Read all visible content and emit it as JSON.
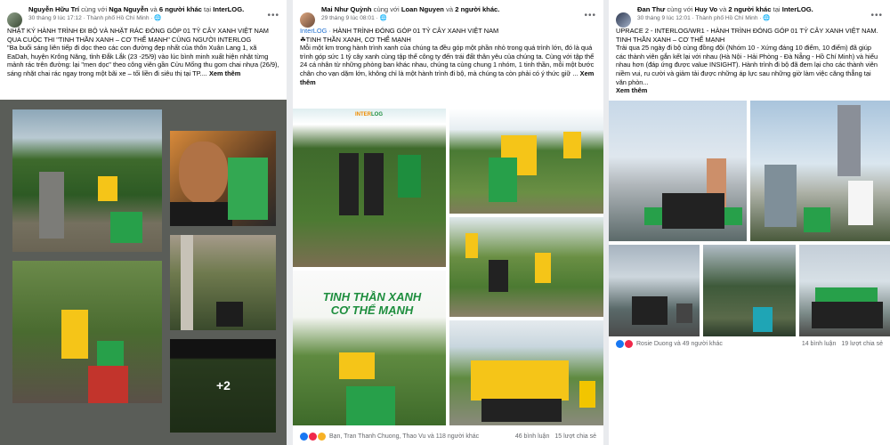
{
  "posts": [
    {
      "author": "Nguyễn Hữu Trí",
      "with_text": "cùng với",
      "with_person": "Nga Nguyễn",
      "and_text": "và",
      "others": "6 người khác",
      "at_text": "tại",
      "place": "InterLOG.",
      "time": "30 tháng 9 lúc 17:12 · Thành phố Hồ Chí Minh ·",
      "text_line1": "NHẬT KÝ HÀNH TRÌNH ĐI BỘ VÀ NHẶT RÁC ĐÓNG GÓP 01 TỶ CÂY XANH VIỆT NAM QUA CUỘC THI \"TINH THẦN XANH – CƠ THỂ MẠNH\" CÙNG NGƯỜI INTERLOG",
      "text_line2": "\"Ba buổi sáng liên tiếp đi dọc theo các con đường đẹp nhất của thôn Xuân Lang 1, xã EaDah, huyện Krông Năng, tỉnh Đắk Lắk (23 -25/9) vào lúc bình minh xuất hiện nhặt từng mảnh rác trên đường: lại \"men dọc\" theo công viên gần Cửu Mống thu gom chai nhựa (26/9), sáng nhặt chai rác ngay trong một bãi xe – tối liền đi siêu thị tại TP....",
      "see_more": "Xem thêm",
      "plus_more": "+2"
    },
    {
      "author": "Mai Như Quỳnh",
      "with_text": "cùng với",
      "with_person": "Loan Nguyen",
      "and_text": "và",
      "others": "2 người khác.",
      "time": "29 tháng 9 lúc 08:01 ·",
      "line_a": "InterLOG ·",
      "line_b": "HÀNH TRÌNH ĐÓNG GÓP 01 TỶ CÂY XANH VIỆT NAM",
      "line_c": "TINH THẦN XANH, CƠ THỂ MẠNH",
      "paragraph": "Mỗi một km trong hành trình xanh của chúng ta đều góp một phần nhỏ trong quá trình lớn, đó là quá trình góp sức 1 tỷ cây xanh cùng tập thể công ty đến trái đất thân yêu của chúng ta. Cùng với tập thể 24 cá nhân từ những phòng ban khác nhau, chúng ta cùng chung 1 nhóm, 1 tinh thần, mỗi một bước chân cho vạn dặm lớn, không chỉ là một hành trình đi bộ, mà chúng ta còn phải có ý thức giữ ...",
      "see_more": "Xem thêm",
      "banner_logo_a": "INTER",
      "banner_logo_b": "LOG",
      "banner_title_a": "TINH THẦN XANH",
      "banner_title_b": "CƠ THỂ MẠNH",
      "reactions": "Bạn, Tran Thanh Chuong, Thao Vu và 118 người khác",
      "comments": "46 bình luận",
      "shares": "15 lượt chia sẻ"
    },
    {
      "author": "Đan Thư",
      "with_text": "cùng với",
      "with_person": "Huy Vo",
      "and_text": "và",
      "others": "2 người khác",
      "at_text": "tại",
      "place": "InterLOG.",
      "time": "30 tháng 9 lúc 12:01 · Thành phố Hồ Chí Minh ·",
      "line_a": "UPRACE 2 - INTERLOG/WR1 - HÀNH TRÌNH ĐÓNG GÓP 01 TỶ CÂY XANH VIỆT NAM.",
      "line_b": "TINH THẦN XANH – CƠ THỂ MẠNH",
      "paragraph": "Trải qua 25 ngày đi bộ cùng đồng đội (Nhóm 10 - Xứng đáng 10 điểm, 10 điểm) đã giúp các thành viên gắn kết lại với nhau (Hà Nội - Hải Phòng - Đà Nẵng - Hồ Chí Minh) và hiểu nhau hơn (đáp ứng được value INSIGHT). Hành trình đi bộ đã đem lại cho các thành viên niềm vui, ru cười và giảm tải được những áp lực sau những giờ làm việc căng thẳng tại văn phòn...",
      "see_more": "Xem thêm",
      "reactions": "Rosie Duong và 49 người khác",
      "comments": "14 bình luận",
      "shares": "19 lượt chia sẻ"
    }
  ],
  "colors": {
    "green": "#1e8e3e",
    "yellow": "#f5c518",
    "link": "#1f6fd0"
  }
}
